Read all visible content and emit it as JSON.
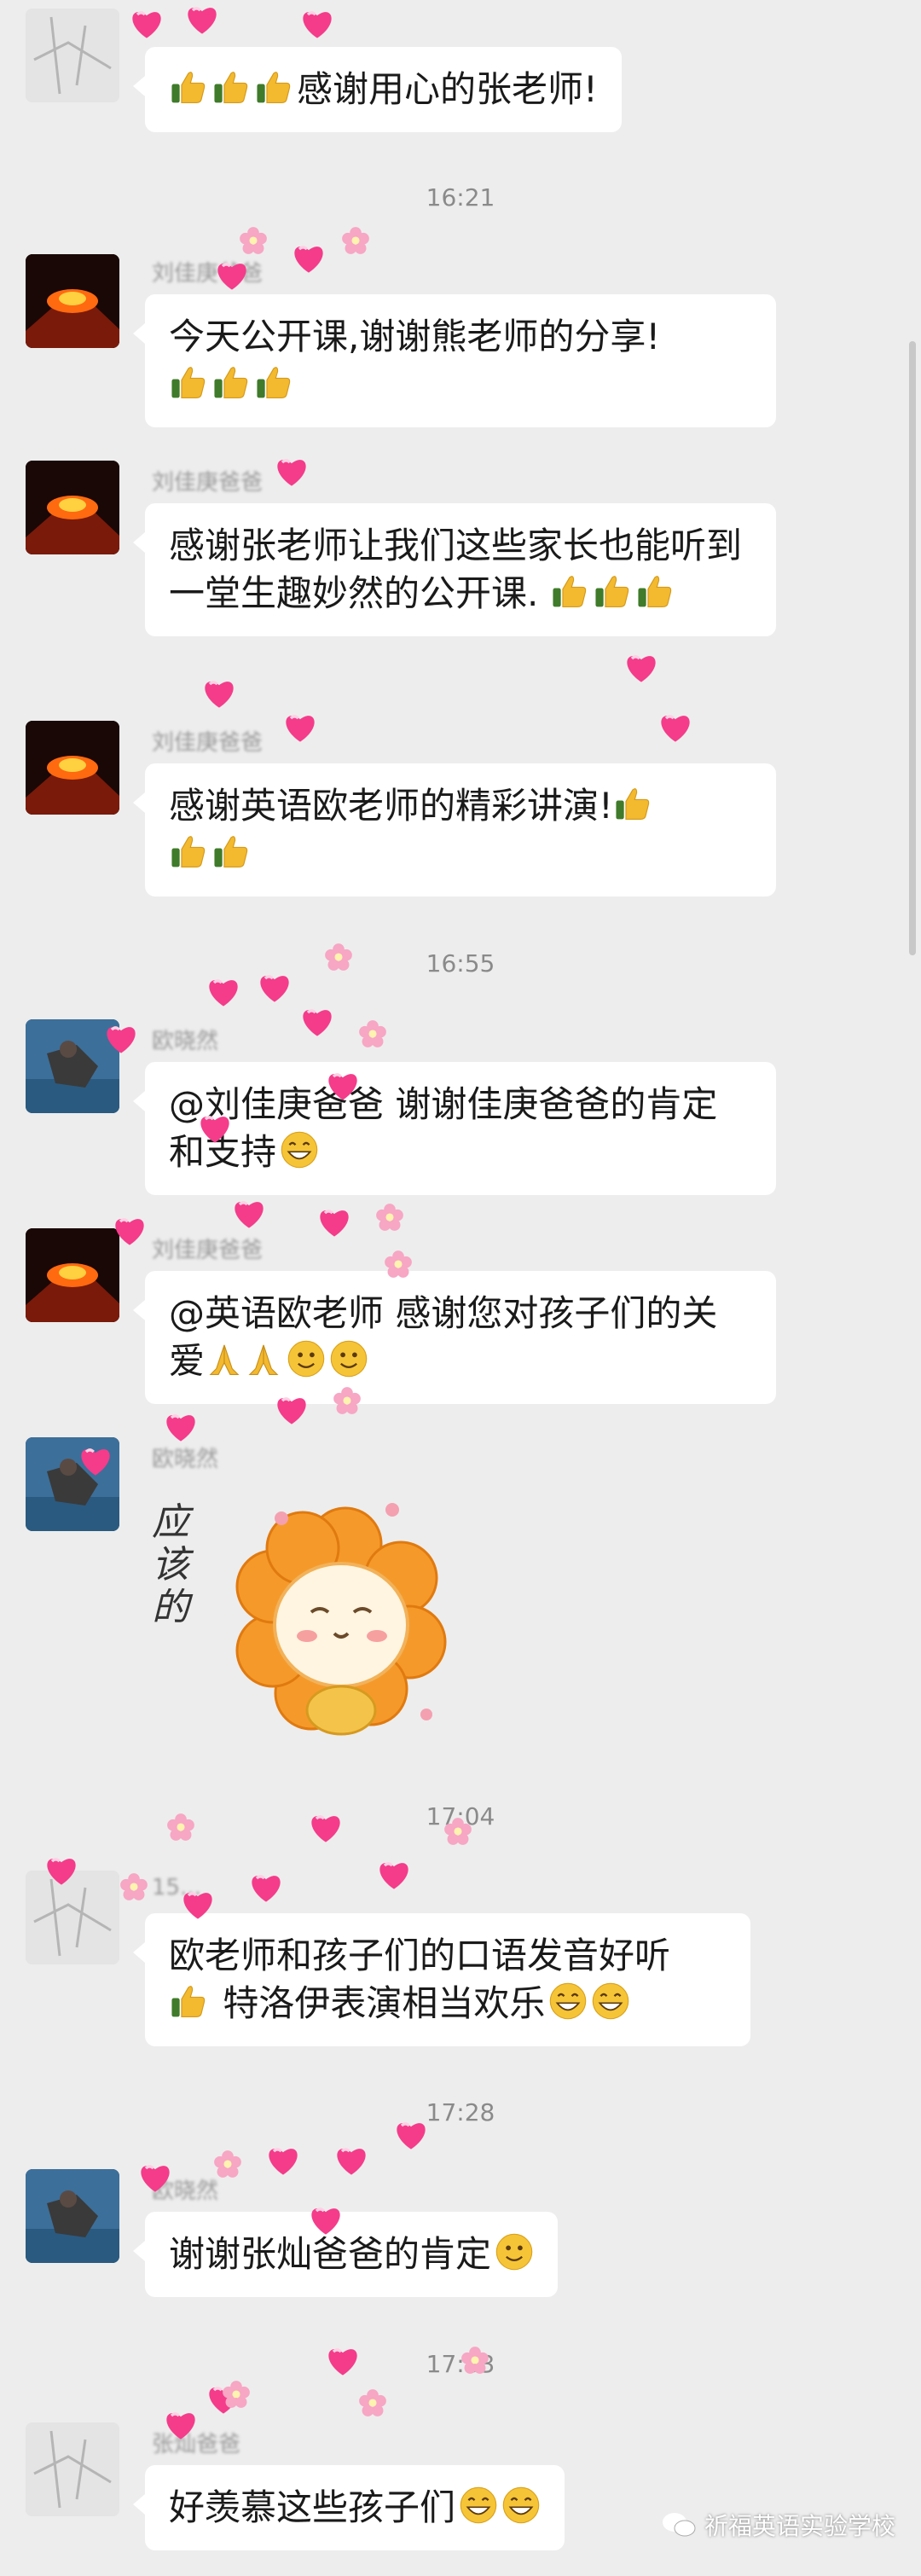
{
  "messages": [
    {
      "text": "感谢用心的张老师!"
    },
    {
      "time": "16:21"
    },
    {
      "text": "今天公开课,谢谢熊老师的分享!"
    },
    {
      "text": "感谢张老师让我们这些家长也能听到一堂生趣妙然的公开课."
    },
    {
      "text": "感谢英语欧老师的精彩讲演!"
    },
    {
      "time": "16:55"
    },
    {
      "text": "@刘佳庚爸爸  谢谢佳庚爸爸的肯定和支持"
    },
    {
      "text": "@英语欧老师  感谢您对孩子们的关爱"
    },
    {
      "sticker_text": "应该的"
    },
    {
      "time": "17:04"
    },
    {
      "text_line1": "欧老师和孩子们的口语发音好听",
      "text_line2": "特洛伊表演相当欢乐"
    },
    {
      "time": "17:28"
    },
    {
      "text": "谢谢张灿爸爸的肯定"
    },
    {
      "time": "17:33"
    },
    {
      "text": "好羡慕这些孩子们"
    }
  ],
  "names": {
    "n1": "刘佳庚爸爸",
    "n2": "刘佳庚爸爸",
    "n3": "刘佳庚爸爸",
    "n4": "欧晓然",
    "n5": "刘佳庚爸爸",
    "n6": "欧晓然",
    "n7": "15...",
    "n8": "欧晓然",
    "n9": "张灿爸爸"
  },
  "watermark": "祈福英语实验学校"
}
